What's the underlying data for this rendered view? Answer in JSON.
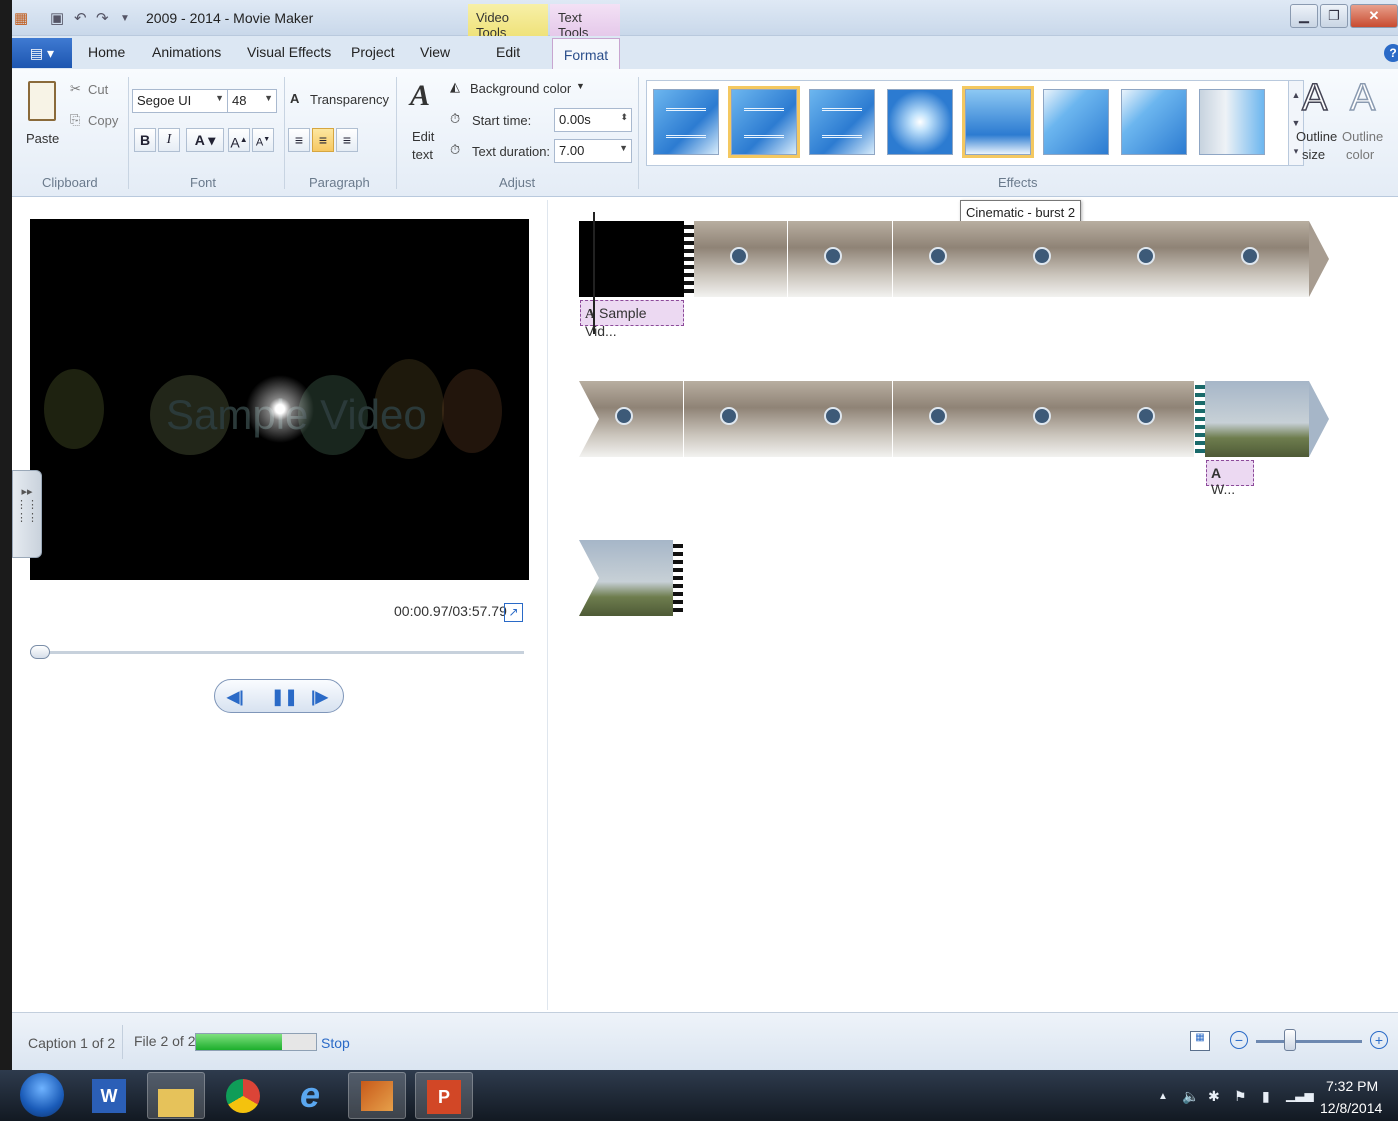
{
  "window": {
    "title": "2009 - 2014 - Movie Maker",
    "context_tabs": [
      "Video Tools",
      "Text Tools"
    ]
  },
  "tabs": [
    "Home",
    "Animations",
    "Visual Effects",
    "Project",
    "View",
    "Edit",
    "Format"
  ],
  "active_tab": "Format",
  "clipboard": {
    "paste": "Paste",
    "cut": "Cut",
    "copy": "Copy",
    "label": "Clipboard"
  },
  "font": {
    "family": "Segoe UI",
    "size": "48",
    "label": "Font"
  },
  "paragraph": {
    "transparency": "Transparency",
    "label": "Paragraph"
  },
  "adjust": {
    "edit_text_line1": "Edit",
    "edit_text_line2": "text",
    "background_color": "Background color",
    "start_time_label": "Start time:",
    "start_time_value": "0.00s",
    "duration_label": "Text duration:",
    "duration_value": "7.00",
    "label": "Adjust"
  },
  "effects": {
    "label": "Effects",
    "tooltip": "Cinematic - burst 2",
    "outline_size_1": "Outline",
    "outline_size_2": "size",
    "outline_color_1": "Outline",
    "outline_color_2": "color"
  },
  "preview": {
    "ghost_text": "Sample Video",
    "time": "00:00.97/03:57.79"
  },
  "storyboard": {
    "caption1": "Sample Vid...",
    "caption2": "W..."
  },
  "status": {
    "caption": "Caption 1 of 2",
    "file": "File 2 of 2",
    "progress": 0.72,
    "stop": "Stop"
  },
  "taskbar": {
    "time": "7:32 PM",
    "date": "12/8/2014"
  },
  "colors": {
    "accent": "#2a6ac7",
    "selected": "#f4c860",
    "caption_bg": "#ecd9f2"
  }
}
